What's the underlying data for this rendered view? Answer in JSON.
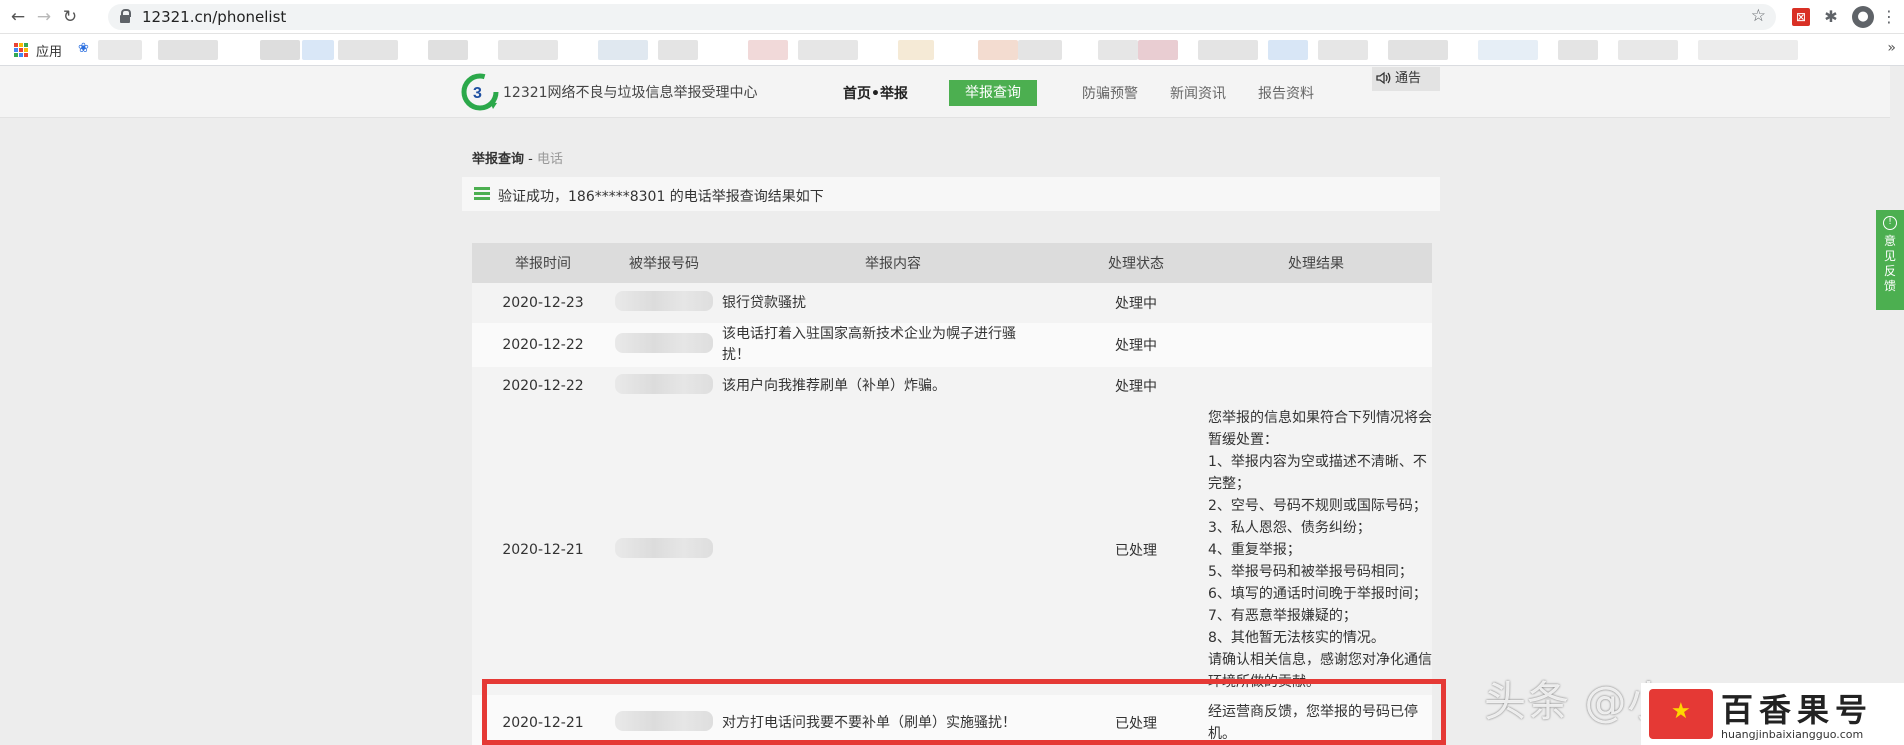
{
  "browser": {
    "url": "12321.cn/phonelist",
    "apps_label": "应用"
  },
  "site": {
    "name": "12321网络不良与垃圾信息举报受理中心",
    "nav": [
      "首页•举报",
      "举报查询",
      "防骗预警",
      "新闻资讯",
      "报告资料"
    ],
    "notice": "通告"
  },
  "breadcrumb": {
    "main": "举报查询",
    "separator": " - ",
    "sub": "电话"
  },
  "verify_message": "验证成功，186*****8301 的电话举报查询结果如下",
  "table": {
    "headers": [
      "举报时间",
      "被举报号码",
      "举报内容",
      "处理状态",
      "处理结果"
    ],
    "rows": [
      {
        "date": "2020-12-23",
        "content": "银行贷款骚扰",
        "status": "处理中",
        "result": []
      },
      {
        "date": "2020-12-22",
        "content": "该电话打着入驻国家高新技术企业为幌子进行骚扰！",
        "status": "处理中",
        "result": []
      },
      {
        "date": "2020-12-22",
        "content": "该用户向我推荐刷单（补单）炸骗。",
        "status": "处理中",
        "result": []
      },
      {
        "date": "2020-12-21",
        "content": "",
        "status": "已处理",
        "result": [
          "您举报的信息如果符合下列情况将会",
          "暂缓处置：",
          "1、举报内容为空或描述不清晰、不",
          "完整；",
          "2、空号、号码不规则或国际号码；",
          "3、私人恩怨、债务纠纷；",
          "4、重复举报；",
          "5、举报号码和被举报号码相同；",
          "6、填写的通话时间晚于举报时间；",
          "7、有恶意举报嫌疑的；",
          "8、其他暂无法核实的情况。",
          "请确认相关信息，感谢您对净化通信",
          "环境所做的贡献。"
        ]
      },
      {
        "date": "2020-12-21",
        "content": "对方打电话问我要不要补单（刷单）实施骚扰！",
        "status": "已处理",
        "result": [
          "经运营商反馈，您举报的号码已停",
          "机。"
        ]
      }
    ]
  },
  "feedback_label": "意见反馈",
  "watermark": {
    "text": "头条 @小",
    "badge_title": "百香果号",
    "badge_sub": "huangjinbaixiangguo.com"
  },
  "colors": {
    "accent_green": "#4caf50",
    "highlight_red": "#e53935"
  }
}
